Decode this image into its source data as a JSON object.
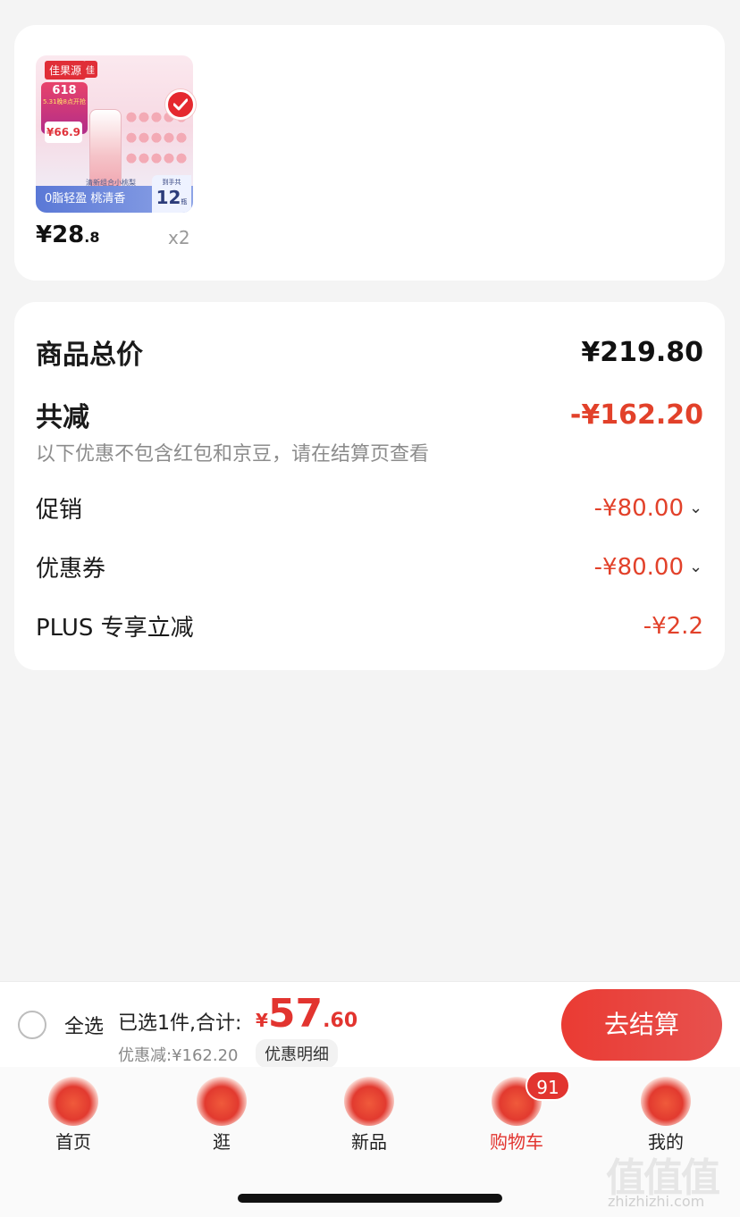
{
  "product": {
    "thumbnail": {
      "brand": "佳果源",
      "brand_small": "佳",
      "promo_title": "618",
      "promo_sub": "5.31晚8点开抢",
      "price_tag": "¥66.9",
      "banner": "0脂轻盈 桃清香",
      "sub_banner": "清新组合小桃梨",
      "count_label": "到手共",
      "count": "12",
      "count_unit": "瓶"
    },
    "price_int": "¥28",
    "price_dec": ".8",
    "quantity": "x2",
    "selected": true
  },
  "summary": {
    "total_label": "商品总价",
    "total_value": "¥219.80",
    "reduce_label": "共减",
    "reduce_value": "-¥162.20",
    "note": "以下优惠不包含红包和京豆，请在结算页查看",
    "promo_label": "促销",
    "promo_value": "-¥80.00",
    "coupon_label": "优惠券",
    "coupon_value": "-¥80.00",
    "plus_label": "PLUS 专享立减",
    "plus_value": "-¥2.2"
  },
  "checkout": {
    "select_all": "全选",
    "selected_text": "已选1件,合计:",
    "sum_currency": "¥",
    "sum_int": "57",
    "sum_dec": ".60",
    "discount_text": "优惠减:¥162.20",
    "detail_button": "优惠明细",
    "go_button": "去结算"
  },
  "tabs": [
    {
      "label": "首页",
      "icon": "home-icon"
    },
    {
      "label": "逛",
      "icon": "guang-icon"
    },
    {
      "label": "新品",
      "icon": "box-icon"
    },
    {
      "label": "购物车",
      "icon": "cart-icon",
      "badge": "91",
      "active": true
    },
    {
      "label": "我的",
      "icon": "profile-icon"
    }
  ],
  "watermark": {
    "logo": "值值值",
    "url": "zhizhizhi.com"
  },
  "colors": {
    "accent": "#e2342f",
    "discount": "#e2412a",
    "background": "#f4f4f4"
  }
}
